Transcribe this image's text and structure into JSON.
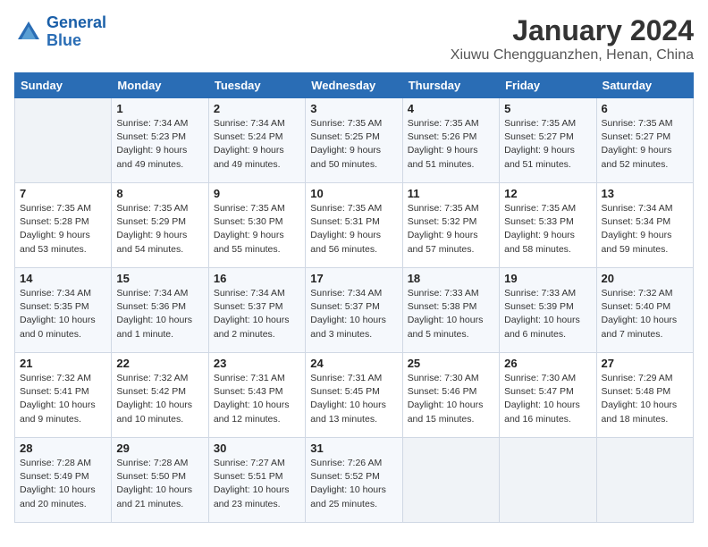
{
  "logo": {
    "text_general": "General",
    "text_blue": "Blue"
  },
  "header": {
    "month": "January 2024",
    "location": "Xiuwu Chengguanzhen, Henan, China"
  },
  "days_of_week": [
    "Sunday",
    "Monday",
    "Tuesday",
    "Wednesday",
    "Thursday",
    "Friday",
    "Saturday"
  ],
  "weeks": [
    [
      {
        "day": "",
        "sunrise": "",
        "sunset": "",
        "daylight": ""
      },
      {
        "day": "1",
        "sunrise": "Sunrise: 7:34 AM",
        "sunset": "Sunset: 5:23 PM",
        "daylight": "Daylight: 9 hours and 49 minutes."
      },
      {
        "day": "2",
        "sunrise": "Sunrise: 7:34 AM",
        "sunset": "Sunset: 5:24 PM",
        "daylight": "Daylight: 9 hours and 49 minutes."
      },
      {
        "day": "3",
        "sunrise": "Sunrise: 7:35 AM",
        "sunset": "Sunset: 5:25 PM",
        "daylight": "Daylight: 9 hours and 50 minutes."
      },
      {
        "day": "4",
        "sunrise": "Sunrise: 7:35 AM",
        "sunset": "Sunset: 5:26 PM",
        "daylight": "Daylight: 9 hours and 51 minutes."
      },
      {
        "day": "5",
        "sunrise": "Sunrise: 7:35 AM",
        "sunset": "Sunset: 5:27 PM",
        "daylight": "Daylight: 9 hours and 51 minutes."
      },
      {
        "day": "6",
        "sunrise": "Sunrise: 7:35 AM",
        "sunset": "Sunset: 5:27 PM",
        "daylight": "Daylight: 9 hours and 52 minutes."
      }
    ],
    [
      {
        "day": "7",
        "sunrise": "Sunrise: 7:35 AM",
        "sunset": "Sunset: 5:28 PM",
        "daylight": "Daylight: 9 hours and 53 minutes."
      },
      {
        "day": "8",
        "sunrise": "Sunrise: 7:35 AM",
        "sunset": "Sunset: 5:29 PM",
        "daylight": "Daylight: 9 hours and 54 minutes."
      },
      {
        "day": "9",
        "sunrise": "Sunrise: 7:35 AM",
        "sunset": "Sunset: 5:30 PM",
        "daylight": "Daylight: 9 hours and 55 minutes."
      },
      {
        "day": "10",
        "sunrise": "Sunrise: 7:35 AM",
        "sunset": "Sunset: 5:31 PM",
        "daylight": "Daylight: 9 hours and 56 minutes."
      },
      {
        "day": "11",
        "sunrise": "Sunrise: 7:35 AM",
        "sunset": "Sunset: 5:32 PM",
        "daylight": "Daylight: 9 hours and 57 minutes."
      },
      {
        "day": "12",
        "sunrise": "Sunrise: 7:35 AM",
        "sunset": "Sunset: 5:33 PM",
        "daylight": "Daylight: 9 hours and 58 minutes."
      },
      {
        "day": "13",
        "sunrise": "Sunrise: 7:34 AM",
        "sunset": "Sunset: 5:34 PM",
        "daylight": "Daylight: 9 hours and 59 minutes."
      }
    ],
    [
      {
        "day": "14",
        "sunrise": "Sunrise: 7:34 AM",
        "sunset": "Sunset: 5:35 PM",
        "daylight": "Daylight: 10 hours and 0 minutes."
      },
      {
        "day": "15",
        "sunrise": "Sunrise: 7:34 AM",
        "sunset": "Sunset: 5:36 PM",
        "daylight": "Daylight: 10 hours and 1 minute."
      },
      {
        "day": "16",
        "sunrise": "Sunrise: 7:34 AM",
        "sunset": "Sunset: 5:37 PM",
        "daylight": "Daylight: 10 hours and 2 minutes."
      },
      {
        "day": "17",
        "sunrise": "Sunrise: 7:34 AM",
        "sunset": "Sunset: 5:37 PM",
        "daylight": "Daylight: 10 hours and 3 minutes."
      },
      {
        "day": "18",
        "sunrise": "Sunrise: 7:33 AM",
        "sunset": "Sunset: 5:38 PM",
        "daylight": "Daylight: 10 hours and 5 minutes."
      },
      {
        "day": "19",
        "sunrise": "Sunrise: 7:33 AM",
        "sunset": "Sunset: 5:39 PM",
        "daylight": "Daylight: 10 hours and 6 minutes."
      },
      {
        "day": "20",
        "sunrise": "Sunrise: 7:32 AM",
        "sunset": "Sunset: 5:40 PM",
        "daylight": "Daylight: 10 hours and 7 minutes."
      }
    ],
    [
      {
        "day": "21",
        "sunrise": "Sunrise: 7:32 AM",
        "sunset": "Sunset: 5:41 PM",
        "daylight": "Daylight: 10 hours and 9 minutes."
      },
      {
        "day": "22",
        "sunrise": "Sunrise: 7:32 AM",
        "sunset": "Sunset: 5:42 PM",
        "daylight": "Daylight: 10 hours and 10 minutes."
      },
      {
        "day": "23",
        "sunrise": "Sunrise: 7:31 AM",
        "sunset": "Sunset: 5:43 PM",
        "daylight": "Daylight: 10 hours and 12 minutes."
      },
      {
        "day": "24",
        "sunrise": "Sunrise: 7:31 AM",
        "sunset": "Sunset: 5:45 PM",
        "daylight": "Daylight: 10 hours and 13 minutes."
      },
      {
        "day": "25",
        "sunrise": "Sunrise: 7:30 AM",
        "sunset": "Sunset: 5:46 PM",
        "daylight": "Daylight: 10 hours and 15 minutes."
      },
      {
        "day": "26",
        "sunrise": "Sunrise: 7:30 AM",
        "sunset": "Sunset: 5:47 PM",
        "daylight": "Daylight: 10 hours and 16 minutes."
      },
      {
        "day": "27",
        "sunrise": "Sunrise: 7:29 AM",
        "sunset": "Sunset: 5:48 PM",
        "daylight": "Daylight: 10 hours and 18 minutes."
      }
    ],
    [
      {
        "day": "28",
        "sunrise": "Sunrise: 7:28 AM",
        "sunset": "Sunset: 5:49 PM",
        "daylight": "Daylight: 10 hours and 20 minutes."
      },
      {
        "day": "29",
        "sunrise": "Sunrise: 7:28 AM",
        "sunset": "Sunset: 5:50 PM",
        "daylight": "Daylight: 10 hours and 21 minutes."
      },
      {
        "day": "30",
        "sunrise": "Sunrise: 7:27 AM",
        "sunset": "Sunset: 5:51 PM",
        "daylight": "Daylight: 10 hours and 23 minutes."
      },
      {
        "day": "31",
        "sunrise": "Sunrise: 7:26 AM",
        "sunset": "Sunset: 5:52 PM",
        "daylight": "Daylight: 10 hours and 25 minutes."
      },
      {
        "day": "",
        "sunrise": "",
        "sunset": "",
        "daylight": ""
      },
      {
        "day": "",
        "sunrise": "",
        "sunset": "",
        "daylight": ""
      },
      {
        "day": "",
        "sunrise": "",
        "sunset": "",
        "daylight": ""
      }
    ]
  ]
}
